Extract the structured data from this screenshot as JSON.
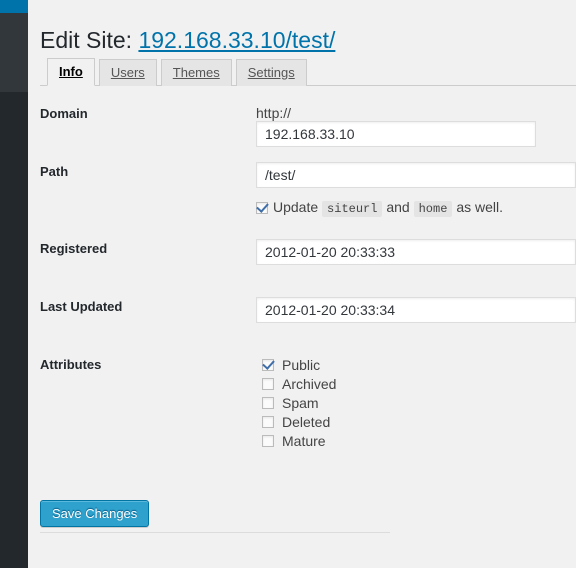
{
  "sidebar": {
    "admin_bar_color": "#0073aa",
    "menu_color": "#32373c",
    "body_color": "#23282d"
  },
  "header": {
    "title_prefix": "Edit Site: ",
    "site_url": "192.168.33.10/test/",
    "link_color": "#0073aa"
  },
  "tabs": [
    {
      "label": "Info",
      "active": true
    },
    {
      "label": "Users",
      "active": false
    },
    {
      "label": "Themes",
      "active": false
    },
    {
      "label": "Settings",
      "active": false
    }
  ],
  "fields": {
    "domain": {
      "label": "Domain",
      "protocol_prefix": "http://",
      "value": "192.168.33.10",
      "placeholder": ""
    },
    "path": {
      "label": "Path",
      "value": "/test/",
      "placeholder": "",
      "update_note": {
        "checked": true,
        "text_before": "Update",
        "code_1": "siteurl",
        "text_middle": "and",
        "code_2": "home",
        "text_after": "as well."
      }
    },
    "registered": {
      "label": "Registered",
      "value": "2012-01-20 20:33:33",
      "placeholder": ""
    },
    "last_updated": {
      "label": "Last Updated",
      "value": "2012-01-20 20:33:34",
      "placeholder": ""
    },
    "attributes": {
      "label": "Attributes",
      "items": [
        {
          "label": "Public",
          "checked": true
        },
        {
          "label": "Archived",
          "checked": false
        },
        {
          "label": "Spam",
          "checked": false
        },
        {
          "label": "Deleted",
          "checked": false
        },
        {
          "label": "Mature",
          "checked": false
        }
      ]
    }
  },
  "submit": {
    "save_label": "Save Changes",
    "accent_color": "#2ea2cc"
  }
}
